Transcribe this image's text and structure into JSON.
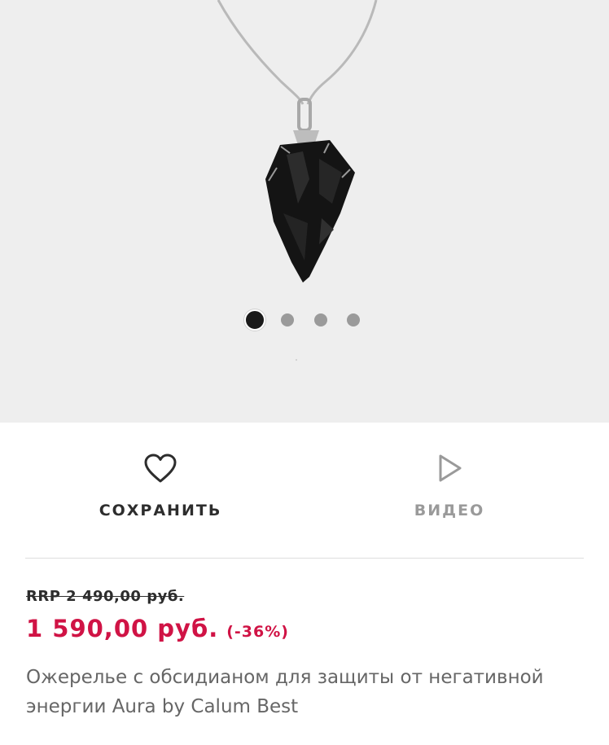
{
  "gallery": {
    "image_alt": "obsidian arrowhead pendant on silver chain",
    "dots": [
      {
        "active": true
      },
      {
        "active": false
      },
      {
        "active": false
      },
      {
        "active": false
      }
    ]
  },
  "actions": {
    "save": {
      "label": "СОХРАНИТЬ",
      "icon": "heart-icon"
    },
    "video": {
      "label": "ВИДЕО",
      "icon": "play-icon"
    }
  },
  "product": {
    "rrp": "RRP 2 490,00 руб.",
    "price": "1 590,00 руб.",
    "discount": "(-36%)",
    "title": "Ожерелье с обсидианом для защиты от негативной энергии Aura by Calum Best"
  },
  "colors": {
    "price": "#d01345",
    "hero_bg": "#eeeeee",
    "muted": "#9a9a9a"
  }
}
